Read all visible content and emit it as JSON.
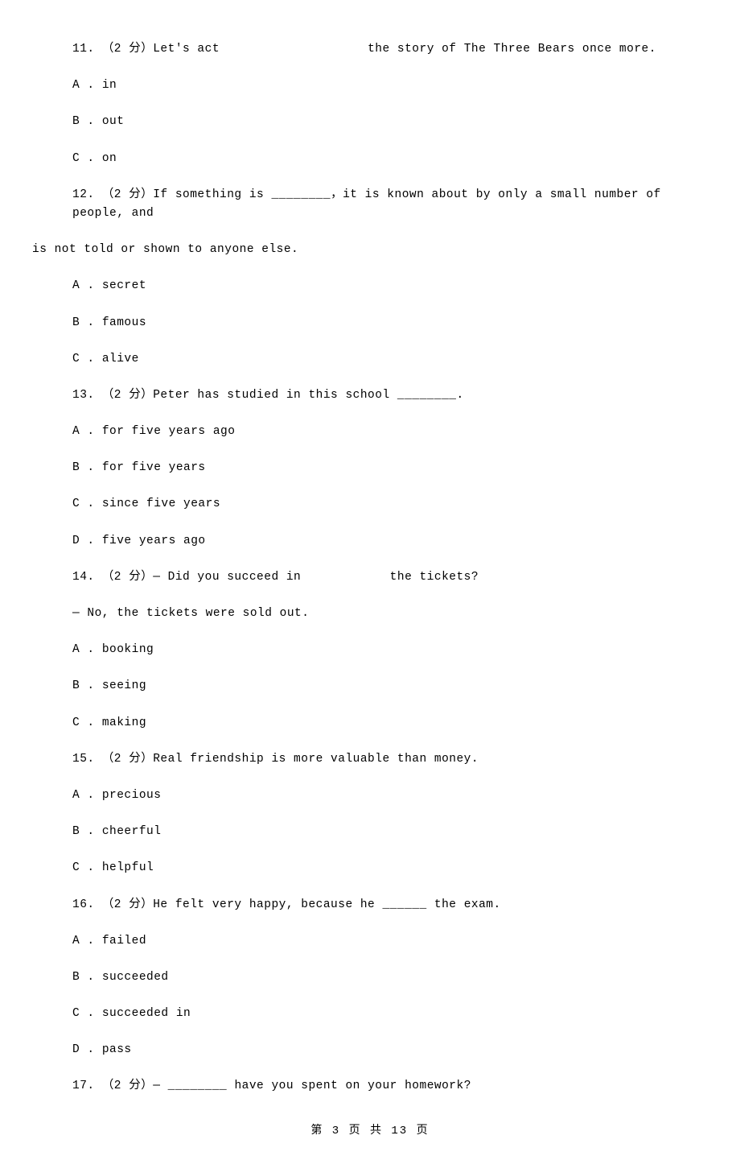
{
  "questions": [
    {
      "num": "11",
      "points": "（2 分）",
      "prompt_before": "Let's act",
      "blank_mode": "space",
      "prompt_after": "the story of The Three Bears once more.",
      "prompt_line2": "",
      "options": [
        {
          "label": "A",
          "text": "in"
        },
        {
          "label": "B",
          "text": "out"
        },
        {
          "label": "C",
          "text": "on"
        }
      ]
    },
    {
      "num": "12",
      "points": "（2 分）",
      "prompt_before": "If something is",
      "blank": "________",
      "prompt_after": "，it is known about by only a small number of people, and",
      "prompt_line2": "is not told or shown to anyone else.",
      "options": [
        {
          "label": "A",
          "text": "secret"
        },
        {
          "label": "B",
          "text": "famous"
        },
        {
          "label": "C",
          "text": "alive"
        }
      ]
    },
    {
      "num": "13",
      "points": "（2 分）",
      "prompt_before": "Peter has studied in this school",
      "blank": "________",
      "prompt_after": ".",
      "prompt_line2": "",
      "options": [
        {
          "label": "A",
          "text": "for five years ago"
        },
        {
          "label": "B",
          "text": "for five years"
        },
        {
          "label": "C",
          "text": "since five years"
        },
        {
          "label": "D",
          "text": "five years ago"
        }
      ]
    },
    {
      "num": "14",
      "points": "（2 分）",
      "prompt_before": "— Did you succeed in",
      "blank_mode": "space",
      "prompt_after": "the tickets?",
      "prompt_line2": "— No, the tickets were sold out.",
      "prompt_line2_indent": true,
      "options": [
        {
          "label": "A",
          "text": "booking"
        },
        {
          "label": "B",
          "text": "seeing"
        },
        {
          "label": "C",
          "text": "making"
        }
      ]
    },
    {
      "num": "15",
      "points": "（2 分）",
      "prompt_before": "Real friendship is more valuable than money.",
      "blank": "",
      "prompt_after": "",
      "prompt_line2": "",
      "options": [
        {
          "label": "A",
          "text": "precious"
        },
        {
          "label": "B",
          "text": "cheerful"
        },
        {
          "label": "C",
          "text": "helpful"
        }
      ]
    },
    {
      "num": "16",
      "points": "（2 分）",
      "prompt_before": "He felt very happy, because he",
      "blank": "______",
      "prompt_after": " the exam.",
      "prompt_line2": "",
      "options": [
        {
          "label": "A",
          "text": "failed"
        },
        {
          "label": "B",
          "text": "succeeded"
        },
        {
          "label": "C",
          "text": "succeeded in"
        },
        {
          "label": "D",
          "text": "pass"
        }
      ]
    },
    {
      "num": "17",
      "points": "（2 分）",
      "prompt_before": "—",
      "blank": "________",
      "prompt_after": " have you spent on your homework?",
      "prompt_line2": "",
      "options": []
    }
  ],
  "footer": "第 3 页 共 13 页"
}
